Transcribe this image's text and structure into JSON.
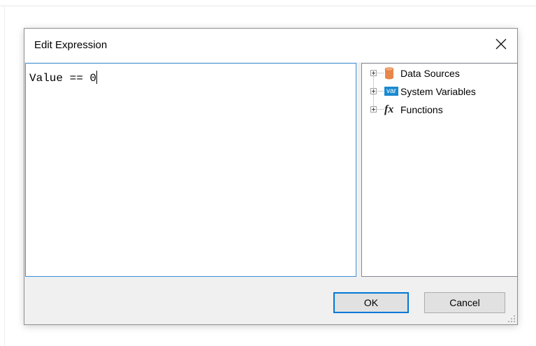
{
  "dialog": {
    "title": "Edit Expression",
    "close_icon": "close-icon"
  },
  "editor": {
    "value": "Value == 0"
  },
  "tree": {
    "items": [
      {
        "label": "Data Sources",
        "icon": "database-icon"
      },
      {
        "label": "System Variables",
        "icon": "var-icon",
        "icon_text": "var"
      },
      {
        "label": "Functions",
        "icon": "function-icon",
        "icon_text": "fx"
      }
    ]
  },
  "buttons": {
    "ok": "OK",
    "cancel": "Cancel"
  },
  "colors": {
    "focus_border": "#3c8fd9",
    "default_button_border": "#0078d7",
    "database_icon": "#e8874a",
    "var_icon_bg": "#1a8ad0"
  }
}
